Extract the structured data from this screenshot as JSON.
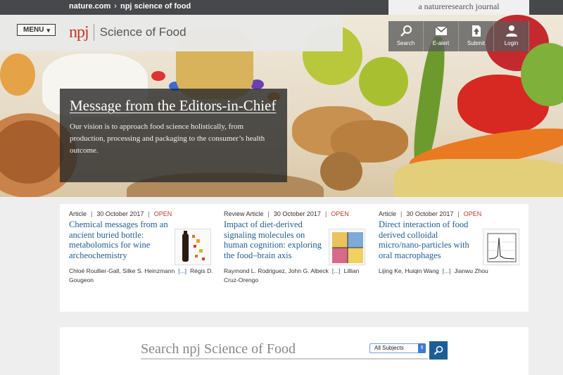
{
  "breadcrumb": {
    "site": "nature.com",
    "section": "npj science of food"
  },
  "journal_tag": "a natureresearch journal",
  "header": {
    "menu_label": "MENU",
    "logo_npj": "npj",
    "logo_title": "Science of Food"
  },
  "actions": [
    {
      "label": "Search",
      "icon": "search-icon"
    },
    {
      "label": "E-alert",
      "icon": "envelope-icon"
    },
    {
      "label": "Submit",
      "icon": "upload-icon"
    },
    {
      "label": "Login",
      "icon": "user-icon"
    }
  ],
  "feature": {
    "title": "Message from the Editors-in-Chief",
    "text": "Our vision is to approach food science holistically, from production, processing and packaging to the consumer’s health outcome."
  },
  "articles": [
    {
      "type": "Article",
      "date": "30 October 2017",
      "access": "OPEN",
      "title": "Chemical messages from an ancient buried bottle: metabolomics for wine archeochemistry",
      "authors": "Chloé Roullier-Gall, Silke S. Heinzmann",
      "more": "[...]",
      "last_author": "Régis D. Gougeon"
    },
    {
      "type": "Review Article",
      "date": "30 October 2017",
      "access": "OPEN",
      "title": "Impact of diet-derived signaling molecules on human cognition: exploring the food–brain axis",
      "authors": "Raymond L. Rodriguez, John G. Albeck",
      "more": "[...]",
      "last_author": "Lillian Cruz-Orengo"
    },
    {
      "type": "Article",
      "date": "30 October 2017",
      "access": "OPEN",
      "title": "Direct interaction of food derived colloidal micro/nano-particles with oral macrophages",
      "authors": "Lijing Ke, Huiqin Wang",
      "more": "[...]",
      "last_author": "Jianwu Zhou"
    }
  ],
  "search": {
    "placeholder": "Search npj Science of Food",
    "subject_selected": "All Subjects"
  },
  "colors": {
    "accent": "#1f5d95",
    "brand": "#c0392b",
    "topbar": "#47484b"
  }
}
